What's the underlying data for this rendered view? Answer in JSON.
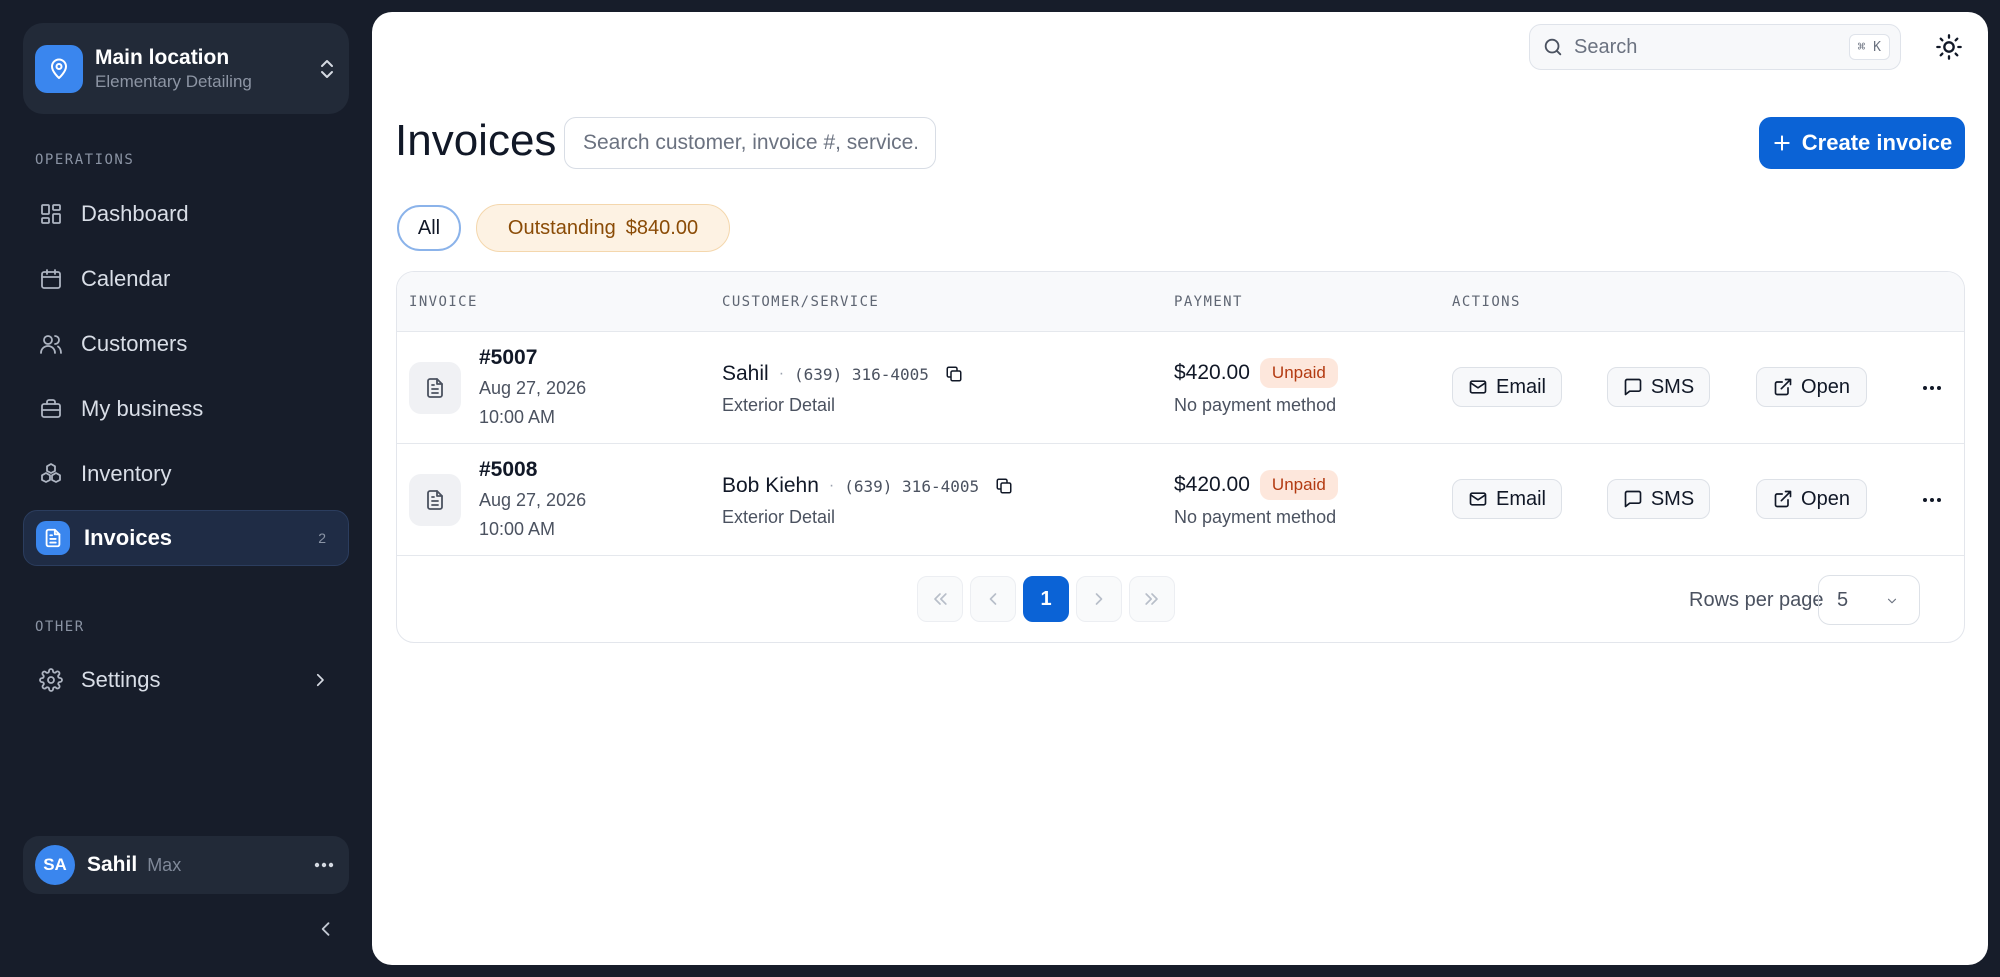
{
  "location": {
    "title": "Main location",
    "subtitle": "Elementary Detailing"
  },
  "sidebar": {
    "operations_label": "OPERATIONS",
    "items": [
      {
        "label": "Dashboard",
        "icon": "dashboard-icon"
      },
      {
        "label": "Calendar",
        "icon": "calendar-icon"
      },
      {
        "label": "Customers",
        "icon": "users-icon"
      },
      {
        "label": "My business",
        "icon": "briefcase-icon"
      },
      {
        "label": "Inventory",
        "icon": "boxes-icon"
      },
      {
        "label": "Invoices",
        "icon": "file-icon",
        "badge": "2",
        "active": true
      }
    ],
    "other_label": "OTHER",
    "settings": {
      "label": "Settings",
      "icon": "gear-icon"
    }
  },
  "user": {
    "initials": "SA",
    "name": "Sahil",
    "plan": "Max"
  },
  "topbar": {
    "search_label": "Search",
    "shortcut": "⌘ K"
  },
  "page": {
    "title": "Invoices",
    "search_placeholder": "Search customer, invoice #, service...",
    "create_label": "Create invoice"
  },
  "filters": {
    "all": "All",
    "outstanding_label": "Outstanding",
    "outstanding_amount": "$840.00"
  },
  "table": {
    "headers": {
      "invoice": "INVOICE",
      "customer": "CUSTOMER/SERVICE",
      "payment": "PAYMENT",
      "actions": "ACTIONS"
    },
    "rows": [
      {
        "number": "#5007",
        "date": "Aug 27, 2026",
        "time": "10:00 AM",
        "customer": "Sahil",
        "phone": "(639) 316-4005",
        "service": "Exterior Detail",
        "amount": "$420.00",
        "status": "Unpaid",
        "payment_method": "No payment method"
      },
      {
        "number": "#5008",
        "date": "Aug 27, 2026",
        "time": "10:00 AM",
        "customer": "Bob Kiehn",
        "phone": "(639) 316-4005",
        "service": "Exterior Detail",
        "amount": "$420.00",
        "status": "Unpaid",
        "payment_method": "No payment method"
      }
    ],
    "actions": {
      "email": "Email",
      "sms": "SMS",
      "open": "Open"
    }
  },
  "pagination": {
    "current_page": "1",
    "rows_label": "Rows per page",
    "rows_value": "5"
  },
  "colors": {
    "accent": "#0b63d6",
    "sidebar_bg": "#171d2a",
    "unpaid_bg": "#fde7dc",
    "unpaid_text": "#b33a11",
    "outstanding_bg": "#fdf2e3"
  }
}
